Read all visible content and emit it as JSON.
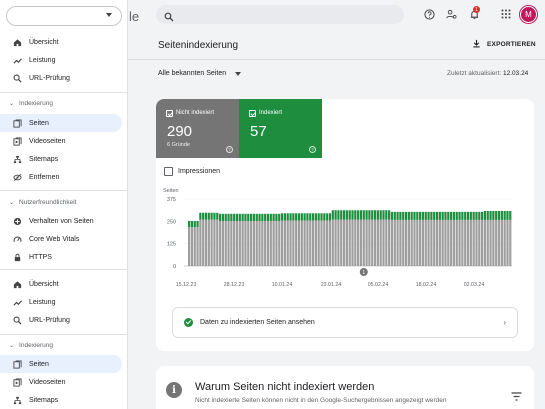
{
  "property_selector": {
    "value": "",
    "suffix": "le"
  },
  "sidebar": {
    "items": [
      {
        "label": "Übersicht",
        "icon": "home-icon"
      },
      {
        "label": "Leistung",
        "icon": "trending-up-icon"
      },
      {
        "label": "URL-Prüfung",
        "icon": "search-icon"
      }
    ],
    "section_indexing": "Indexierung",
    "indexing_items": [
      {
        "label": "Seiten",
        "icon": "pages-icon",
        "active": true
      },
      {
        "label": "Videoseiten",
        "icon": "video-pages-icon"
      },
      {
        "label": "Sitemaps",
        "icon": "sitemaps-icon"
      },
      {
        "label": "Entfernen",
        "icon": "removals-icon"
      }
    ],
    "section_experience": "Nutzerfreundlichkeit",
    "experience_items": [
      {
        "label": "Verhalten von Seiten",
        "icon": "page-experience-icon"
      },
      {
        "label": "Core Web Vitals",
        "icon": "speed-icon"
      },
      {
        "label": "HTTPS",
        "icon": "lock-icon"
      }
    ],
    "repeat_items": [
      {
        "label": "Übersicht",
        "icon": "home-icon"
      },
      {
        "label": "Leistung",
        "icon": "trending-up-icon"
      },
      {
        "label": "URL-Prüfung",
        "icon": "search-icon"
      }
    ],
    "repeat_section": "Indexierung",
    "repeat_indexing_items": [
      {
        "label": "Seiten",
        "icon": "pages-icon",
        "active": true
      },
      {
        "label": "Videoseiten",
        "icon": "video-pages-icon"
      },
      {
        "label": "Sitemaps",
        "icon": "sitemaps-icon"
      }
    ]
  },
  "topbar": {
    "search_placeholder": "",
    "notification_count": "1",
    "avatar_letter": "M"
  },
  "page": {
    "title": "Seitenindexierung",
    "export_label": "EXPORTIEREN",
    "filter_label": "Alle bekannten Seiten",
    "updated_label": "Zuletzt aktualisiert:",
    "updated_date": "12.03.24"
  },
  "tiles": {
    "not_indexed": {
      "label": "Nicht indexiert",
      "value": "290",
      "sub": "6 Gründe",
      "color": "#757575"
    },
    "indexed": {
      "label": "Indexiert",
      "value": "57",
      "color": "#1e8e3e"
    }
  },
  "impressions_label": "Impressionen",
  "chart_data": {
    "type": "bar",
    "stacked": true,
    "ylabel": "Seiten",
    "yticks": [
      0,
      125,
      250,
      375
    ],
    "ylim": [
      0,
      375
    ],
    "xticks": [
      "15.12.23",
      "28.12.23",
      "10.01.24",
      "23.01.24",
      "05.02.24",
      "18.02.24",
      "02.03.24"
    ],
    "annotation_label": "1",
    "series": [
      {
        "color": "#9e9e9e",
        "values": [
          218,
          218,
          218,
          218,
          260,
          260,
          260,
          260,
          260,
          260,
          260,
          252,
          252,
          252,
          252,
          252,
          252,
          252,
          252,
          252,
          252,
          252,
          252,
          252,
          252,
          252,
          252,
          252,
          252,
          252,
          252,
          252,
          252,
          255,
          255,
          255,
          255,
          255,
          255,
          255,
          255,
          255,
          255,
          255,
          255,
          255,
          255,
          255,
          255,
          255,
          255,
          260,
          260,
          260,
          260,
          260,
          260,
          260,
          260,
          260,
          260,
          260,
          260,
          260,
          260,
          260,
          260,
          260,
          260,
          260,
          260,
          260,
          258,
          258,
          258,
          258,
          258,
          258,
          258,
          258,
          258,
          258,
          258,
          258,
          258,
          258,
          258,
          258,
          258,
          258,
          258,
          258,
          258,
          258,
          258,
          258,
          258,
          258,
          258,
          258,
          258,
          258,
          258,
          258,
          258,
          258,
          258,
          258,
          258,
          258,
          258,
          258,
          258,
          258,
          258
        ]
      },
      {
        "color": "#1e8e3e",
        "values": [
          34,
          34,
          34,
          34,
          38,
          38,
          38,
          38,
          38,
          38,
          38,
          40,
          40,
          40,
          40,
          40,
          40,
          40,
          40,
          40,
          40,
          40,
          40,
          40,
          40,
          40,
          40,
          40,
          40,
          40,
          40,
          40,
          40,
          40,
          40,
          40,
          40,
          40,
          40,
          40,
          40,
          40,
          40,
          40,
          40,
          40,
          40,
          40,
          40,
          40,
          40,
          52,
          52,
          52,
          52,
          52,
          52,
          52,
          52,
          52,
          52,
          52,
          52,
          52,
          52,
          52,
          52,
          52,
          52,
          52,
          52,
          52,
          45,
          45,
          45,
          45,
          45,
          45,
          45,
          45,
          45,
          45,
          45,
          45,
          45,
          45,
          45,
          45,
          45,
          45,
          45,
          45,
          45,
          45,
          45,
          45,
          45,
          45,
          45,
          45,
          45,
          45,
          45,
          45,
          45,
          50,
          50,
          50,
          50,
          50,
          50,
          50,
          50,
          50,
          50
        ]
      }
    ]
  },
  "cta_label": "Daten zu indexierten Seiten ansehen",
  "reasons": {
    "title": "Warum Seiten nicht indexiert werden",
    "subtitle": "Nicht indexierte Seiten können nicht in den Google-Suchergebnissen angezeigt werden"
  }
}
